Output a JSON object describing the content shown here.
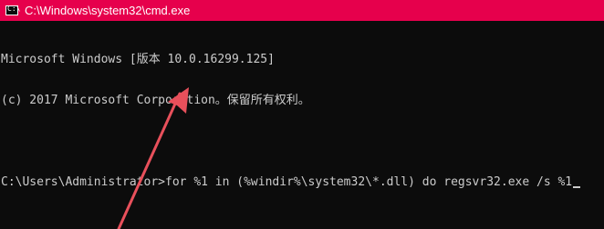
{
  "window": {
    "title": "C:\\Windows\\system32\\cmd.exe",
    "icon": "cmd-console-icon",
    "icon_glyph": "C:\\",
    "titlebar_color": "#e6004c"
  },
  "console": {
    "header_lines": [
      "Microsoft Windows [版本 10.0.16299.125]",
      "(c) 2017 Microsoft Corporation。保留所有权利。"
    ],
    "prompt": "C:\\Users\\Administrator>",
    "command": "for %1 in (%windir%\\system32\\*.dll) do regsvr32.exe /s %1",
    "text_color": "#cccccc",
    "background_color": "#0c0c0c"
  },
  "annotation": {
    "type": "pointer-arrow",
    "color": "#e8505b"
  }
}
